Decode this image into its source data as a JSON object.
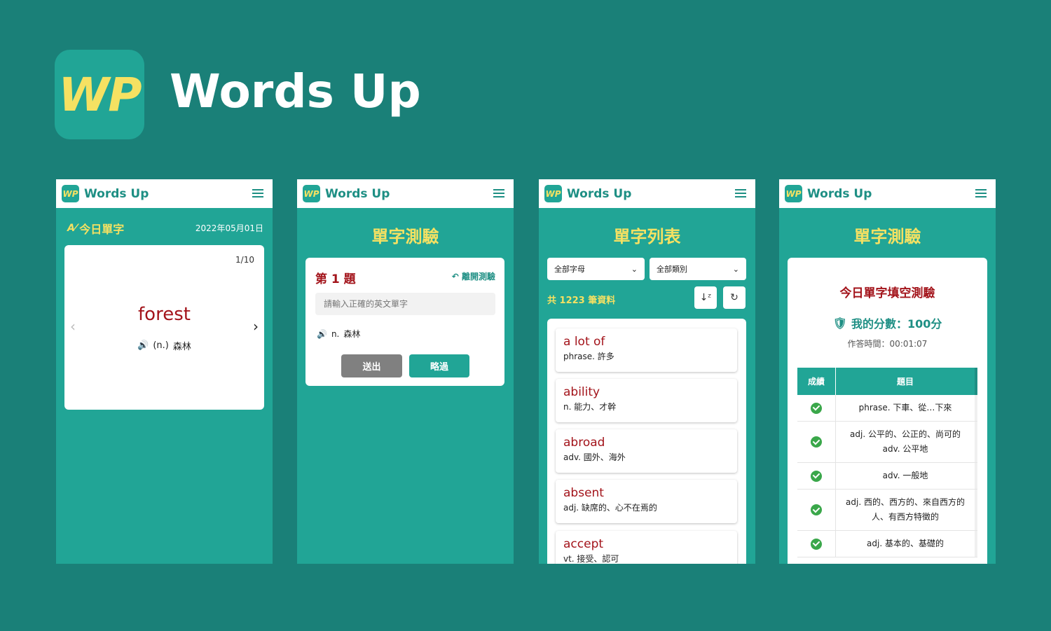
{
  "app": {
    "logo_text": "WP",
    "title": "Words Up"
  },
  "colors": {
    "primary": "#21a596",
    "background": "#1a8078",
    "accent_yellow": "#f5e162",
    "word_red": "#a3141b"
  },
  "icons": {
    "menu": "hamburger-icon",
    "speaker": "speaker-icon",
    "back": "reply-arrow-icon",
    "sort": "sort-az-icon",
    "refresh": "refresh-icon",
    "shield": "shield-check-icon",
    "check": "check-circle-icon"
  },
  "screen1": {
    "heading": "今日單字",
    "date": "2022年05月01日",
    "counter": "1/10",
    "word": "forest",
    "pos": "(n.)",
    "meaning": "森林"
  },
  "screen2": {
    "title": "單字測驗",
    "question_no": "第 1 題",
    "leave": "離開測驗",
    "input_placeholder": "請輸入正確的英文單字",
    "hint_pos": "n.",
    "hint_meaning": "森林",
    "submit": "送出",
    "skip": "略過"
  },
  "screen3": {
    "title": "單字列表",
    "filter_letter": "全部字母",
    "filter_type": "全部類別",
    "count": "共 1223 筆資料",
    "words": [
      {
        "word": "a lot of",
        "def": "phrase. 許多"
      },
      {
        "word": "ability",
        "def": "n. 能力、才幹"
      },
      {
        "word": "abroad",
        "def": "adv. 國外、海外"
      },
      {
        "word": "absent",
        "def": "adj. 缺席的、心不在焉的"
      },
      {
        "word": "accept",
        "def": "vt. 接受、認可"
      }
    ]
  },
  "screen4": {
    "title": "單字測驗",
    "result_title": "今日單字填空測驗",
    "score": "我的分數：100分",
    "time": "作答時間：00:01:07",
    "col_result": "成績",
    "col_question": "題目",
    "rows": [
      {
        "q": "phrase. 下車、從…下來"
      },
      {
        "q1": "adj. 公平的、公正的、尚可的",
        "q2": "adv. 公平地"
      },
      {
        "q": "adv. 一般地"
      },
      {
        "q": "adj. 西的、西方的、來自西方的人、有西方特徵的"
      },
      {
        "q": "adj. 基本的、基礎的"
      }
    ]
  }
}
